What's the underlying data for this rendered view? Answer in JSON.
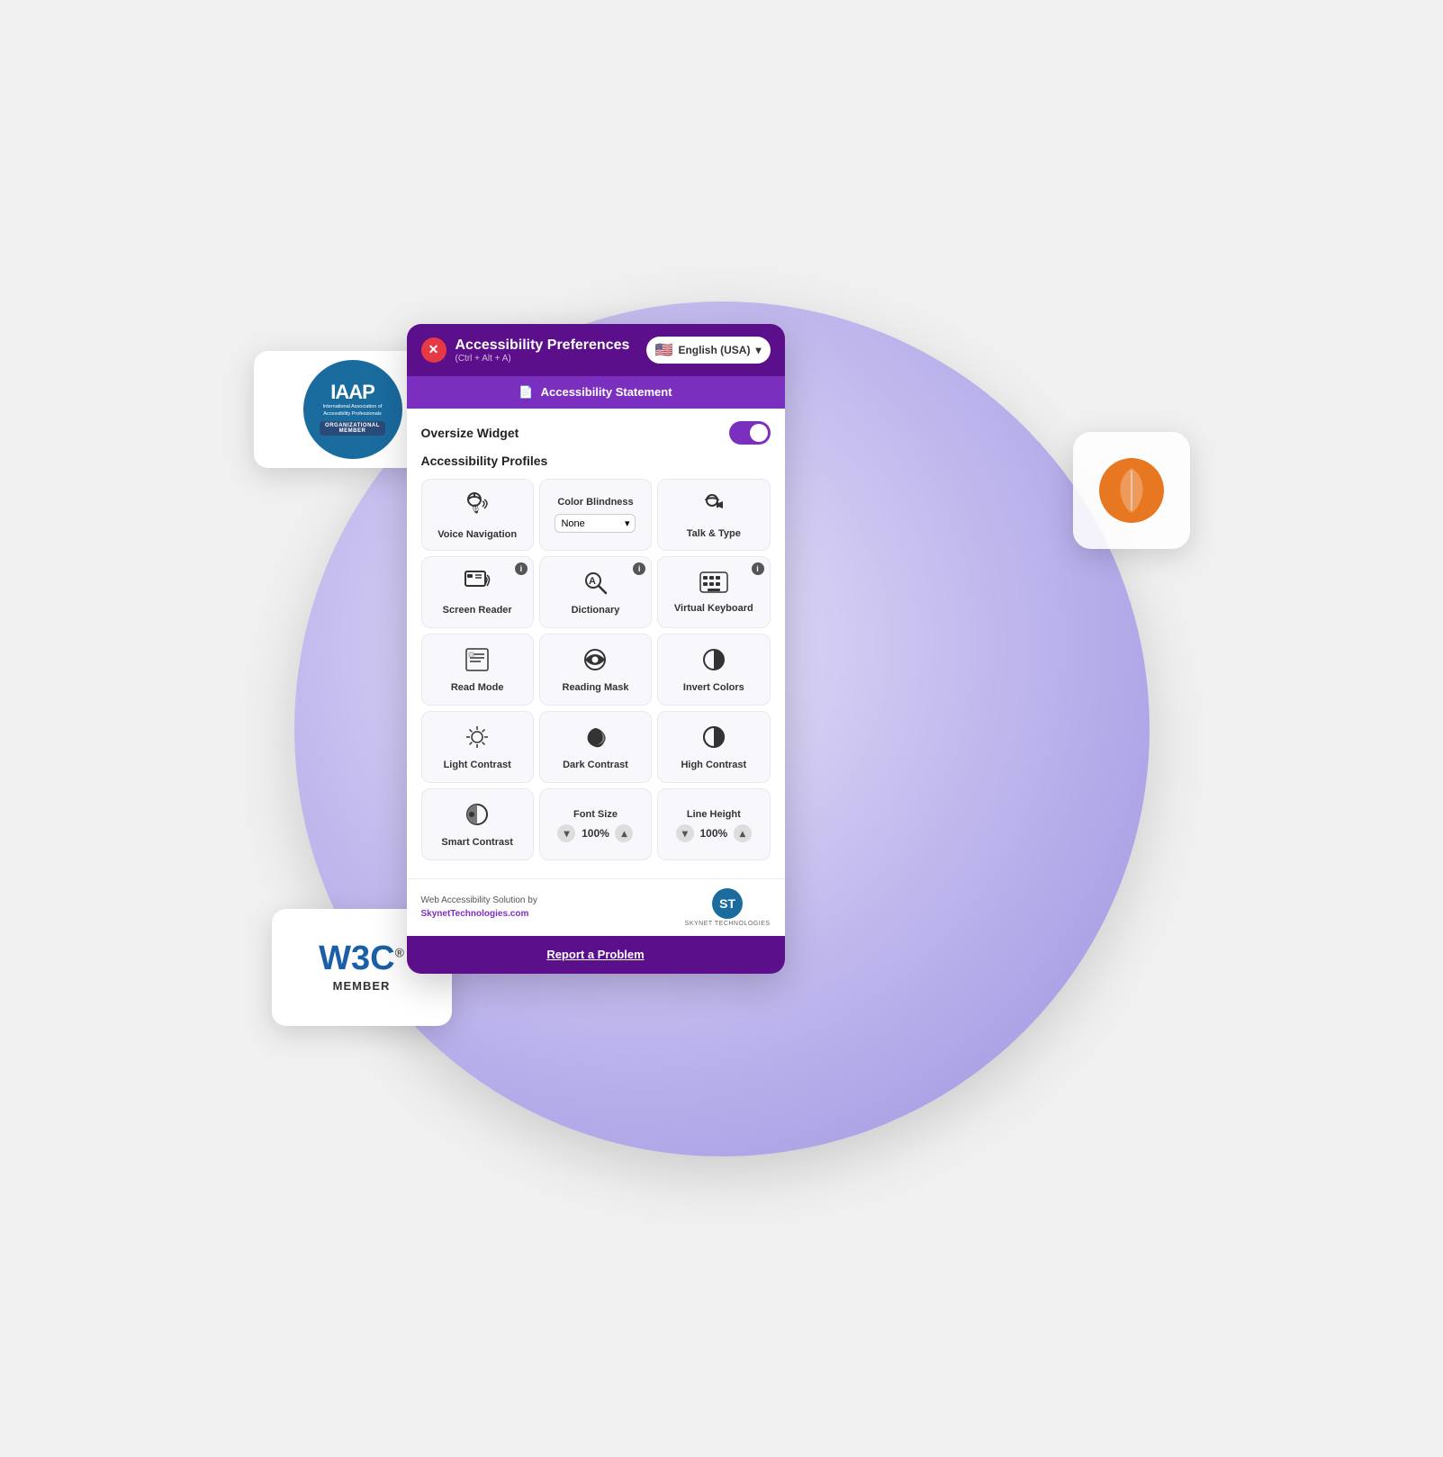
{
  "scene": {
    "background_circle": "radial-gradient ellipse purple"
  },
  "iaap": {
    "title": "IAAP",
    "subtitle": "International Association of Accessibility Professionals",
    "org_label": "ORGANIZATIONAL",
    "member_label": "MEMBER"
  },
  "w3c": {
    "logo": "W3C",
    "registered": "®",
    "member": "MEMBER"
  },
  "panel": {
    "header": {
      "title": "Accessibility Preferences",
      "shortcut": "(Ctrl + Alt + A)",
      "close_label": "✕",
      "lang_label": "English (USA)",
      "lang_chevron": "▾"
    },
    "statement_bar": {
      "icon": "📄",
      "label": "Accessibility Statement"
    },
    "oversize_widget": {
      "label": "Oversize Widget"
    },
    "profiles": {
      "label": "Accessibility Profiles"
    },
    "features": [
      {
        "id": "voice-navigation",
        "icon": "🎤",
        "label": "Voice Navigation",
        "has_info": false,
        "icon_char": "🎙"
      },
      {
        "id": "color-blindness",
        "icon": "👁",
        "label": "Color Blindness",
        "is_dropdown": true,
        "dropdown_value": "None"
      },
      {
        "id": "talk-type",
        "icon": "💬",
        "label": "Talk & Type",
        "has_info": false
      },
      {
        "id": "screen-reader",
        "icon": "📺",
        "label": "Screen Reader",
        "has_info": true
      },
      {
        "id": "dictionary",
        "icon": "🔍",
        "label": "Dictionary",
        "has_info": true
      },
      {
        "id": "virtual-keyboard",
        "icon": "⌨",
        "label": "Virtual Keyboard",
        "has_info": true
      },
      {
        "id": "read-mode",
        "icon": "📋",
        "label": "Read Mode",
        "has_info": false
      },
      {
        "id": "reading-mask",
        "icon": "🔴",
        "label": "Reading Mask",
        "has_info": false
      },
      {
        "id": "invert-colors",
        "icon": "🔵",
        "label": "Invert Colors",
        "has_info": false
      },
      {
        "id": "light-contrast",
        "icon": "☀",
        "label": "Light Contrast",
        "has_info": false
      },
      {
        "id": "dark-contrast",
        "icon": "🌙",
        "label": "Dark Contrast",
        "has_info": false
      },
      {
        "id": "high-contrast",
        "icon": "◑",
        "label": "High Contrast",
        "has_info": false
      }
    ],
    "smart_contrast": {
      "label": "Smart Contrast",
      "has_info": false
    },
    "font_size": {
      "label": "Font Size",
      "value": "100%",
      "down": "▾",
      "up": "▴"
    },
    "line_height": {
      "label": "Line Height",
      "value": "100%",
      "down": "▾",
      "up": "▴"
    },
    "footer": {
      "text_line1": "Web Accessibility Solution by",
      "text_line2": "SkynetTechnologies.com",
      "logo_text": "ST",
      "logo_sub": "SKYNET TECHNOLOGIES"
    },
    "report": {
      "label": "Report a Problem"
    }
  }
}
